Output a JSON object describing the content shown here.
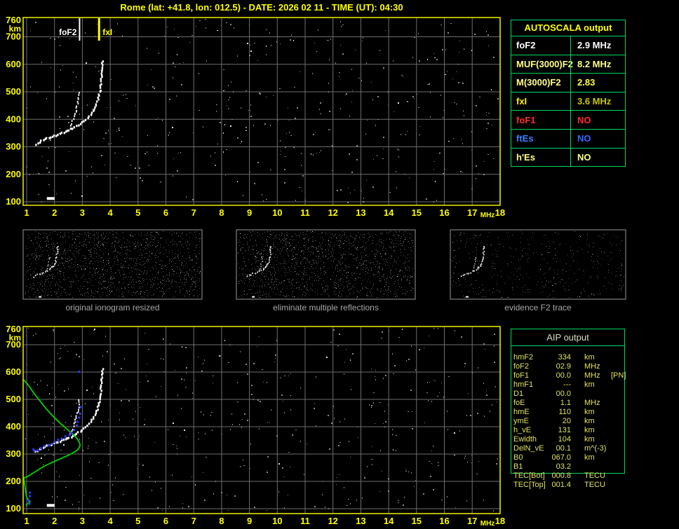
{
  "title": "Rome (lat: +41.8, lon: 012.5) - DATE: 2026 02 11 - TIME (UT): 04:30",
  "colors": {
    "accent_yellow": "#ffff00",
    "plot_border": "#e2e200",
    "grid_gray": "#6e6e6e",
    "table_green": "#00d85c",
    "trace_white": "#fafafa",
    "profile_green": "#00d400",
    "scaled_blue": "#2a3bff",
    "noise_gray": "#8a8a8a",
    "caption_gray": "#a8a8a8",
    "status_no_red": "#ff2a2a",
    "status_no_blue": "#2f6bff"
  },
  "autoscala": {
    "title": "AUTOSCALA output",
    "rows": [
      {
        "param": "foF2",
        "value": "2.9 MHz",
        "param_color": "#ffffff",
        "value_color": "#ffffff"
      },
      {
        "param": "MUF(3000)F2",
        "value": "8.2 MHz",
        "param_color": "#ffff8a",
        "value_color": "#ffff8a"
      },
      {
        "param": "M(3000)F2",
        "value": "2.83",
        "param_color": "#ffff8a",
        "value_color": "#ffff4c"
      },
      {
        "param": "fxI",
        "value": "3.6 MHz",
        "param_color": "#ffee00",
        "value_color": "#c9c900"
      },
      {
        "param": "foF1",
        "value": "NO",
        "param_color": "#ff2a2a",
        "value_color": "#ff2a2a"
      },
      {
        "param": "ftEs",
        "value": "NO",
        "param_color": "#3b82ff",
        "value_color": "#2f6bff"
      },
      {
        "param": "h'Es",
        "value": "NO",
        "param_color": "#ffff8a",
        "value_color": "#ffff8a"
      }
    ]
  },
  "panels": [
    {
      "caption": "original ionogram resized"
    },
    {
      "caption": "eliminate multiple reflections"
    },
    {
      "caption": "evidence F2 trace"
    }
  ],
  "aip": {
    "title": "AIP output",
    "rows": [
      {
        "param": "hmF2",
        "value": "334",
        "unit": "km",
        "extra": ""
      },
      {
        "param": "foF2",
        "value": "02.9",
        "unit": "MHz",
        "extra": ""
      },
      {
        "param": "foF1",
        "value": "00.0",
        "unit": "MHz",
        "extra": "[PN]"
      },
      {
        "param": "hmF1",
        "value": "---",
        "unit": "km",
        "extra": ""
      },
      {
        "param": "D1",
        "value": "00.0",
        "unit": "",
        "extra": ""
      },
      {
        "param": "foE",
        "value": "1.1",
        "unit": "MHz",
        "extra": ""
      },
      {
        "param": "hmE",
        "value": "110",
        "unit": "km",
        "extra": ""
      },
      {
        "param": "ymE",
        "value": "20",
        "unit": "km",
        "extra": ""
      },
      {
        "param": "h_vE",
        "value": "131",
        "unit": "km",
        "extra": ""
      },
      {
        "param": "Ewidth",
        "value": "104",
        "unit": "km",
        "extra": ""
      },
      {
        "param": "DelN_vE",
        "value": "00.1",
        "unit": "m^(-3)",
        "extra": ""
      },
      {
        "param": "B0",
        "value": "067.0",
        "unit": "km",
        "extra": ""
      },
      {
        "param": "B1",
        "value": "03.2",
        "unit": "",
        "extra": ""
      },
      {
        "param": "TEC[Bot]",
        "value": "000.8",
        "unit": "TECU",
        "extra": ""
      },
      {
        "param": "TEC[Top]",
        "value": "001.4",
        "unit": "TECU",
        "extra": ""
      }
    ]
  },
  "chart_data": {
    "type": "scatter",
    "title": "ionogram with autoscaled traces and electron density profile",
    "xlabel": "MHz",
    "ylabel": "km",
    "x_ticks": [
      1,
      2,
      3,
      4,
      5,
      6,
      7,
      8,
      9,
      10,
      11,
      12,
      13,
      14,
      15,
      16,
      17,
      18
    ],
    "y_ticks": [
      760,
      700,
      600,
      500,
      400,
      300,
      200,
      100
    ],
    "xlim": [
      0.87,
      18.05
    ],
    "ylim": [
      87,
      770
    ],
    "markers": [
      {
        "label": "foF2",
        "f": 2.9,
        "color": "#ffffff"
      },
      {
        "label": "fxI",
        "f": 3.6,
        "color": "#ffff00"
      }
    ],
    "x_trace": [
      [
        1.3,
        313
      ],
      [
        1.5,
        324
      ],
      [
        1.7,
        333
      ],
      [
        1.9,
        341
      ],
      [
        2.1,
        348
      ],
      [
        2.3,
        355
      ],
      [
        2.5,
        364
      ],
      [
        2.7,
        374
      ],
      [
        2.9,
        386
      ],
      [
        3.1,
        402
      ],
      [
        3.28,
        421
      ],
      [
        3.43,
        445
      ],
      [
        3.54,
        475
      ],
      [
        3.61,
        510
      ],
      [
        3.65,
        550
      ],
      [
        3.68,
        585
      ],
      [
        3.7,
        615
      ],
      [
        3.71,
        625
      ]
    ],
    "o_trace": [
      [
        2.55,
        378
      ],
      [
        2.63,
        395
      ],
      [
        2.7,
        414
      ],
      [
        2.76,
        436
      ],
      [
        2.81,
        460
      ],
      [
        2.85,
        483
      ],
      [
        2.87,
        500
      ],
      [
        2.88,
        510
      ]
    ],
    "dash_mark": [
      1.85,
      112
    ],
    "profile": [
      [
        0.88,
        572
      ],
      [
        1.0,
        560
      ],
      [
        1.12,
        543
      ],
      [
        1.28,
        520
      ],
      [
        1.48,
        494
      ],
      [
        1.7,
        466
      ],
      [
        1.95,
        438
      ],
      [
        2.2,
        413
      ],
      [
        2.45,
        391
      ],
      [
        2.64,
        374
      ],
      [
        2.78,
        360
      ],
      [
        2.87,
        348
      ],
      [
        2.91,
        337
      ],
      [
        2.92,
        331
      ],
      [
        2.88,
        322
      ],
      [
        2.8,
        313
      ],
      [
        2.66,
        304
      ],
      [
        2.48,
        295
      ],
      [
        2.26,
        285
      ],
      [
        2.02,
        274
      ],
      [
        1.78,
        263
      ],
      [
        1.54,
        250
      ],
      [
        1.33,
        237
      ],
      [
        1.16,
        226
      ],
      [
        1.02,
        217
      ],
      [
        0.9,
        213
      ],
      [
        0.92,
        195
      ],
      [
        0.95,
        175
      ],
      [
        0.97,
        158
      ],
      [
        1.0,
        142
      ],
      [
        1.06,
        132
      ],
      [
        1.12,
        127
      ],
      [
        1.07,
        121
      ],
      [
        1.0,
        115
      ],
      [
        0.98,
        109
      ]
    ],
    "scaled_points": [
      [
        1.22,
        316
      ],
      [
        1.3,
        312
      ],
      [
        1.4,
        314
      ],
      [
        1.52,
        320
      ],
      [
        1.65,
        327
      ],
      [
        1.78,
        333
      ],
      [
        1.9,
        339
      ],
      [
        2.02,
        345
      ],
      [
        2.15,
        351
      ],
      [
        2.28,
        357
      ],
      [
        2.4,
        363
      ],
      [
        2.52,
        370
      ],
      [
        2.62,
        379
      ],
      [
        2.71,
        390
      ],
      [
        2.78,
        403
      ],
      [
        2.84,
        418
      ],
      [
        2.88,
        432
      ],
      [
        2.91,
        450
      ],
      [
        2.93,
        470
      ],
      [
        2.86,
        600
      ]
    ],
    "scaled_points_e": [
      [
        1.12,
        158
      ],
      [
        1.1,
        147
      ],
      [
        1.08,
        128
      ],
      [
        1.1,
        118
      ]
    ]
  }
}
